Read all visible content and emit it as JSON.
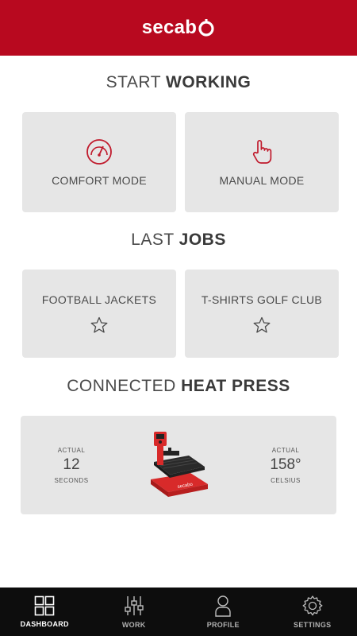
{
  "header": {
    "logo_text": "secab",
    "brand_color": "#b8091f"
  },
  "start_working": {
    "title_light": "START",
    "title_bold": "WORKING",
    "cards": [
      {
        "label": "COMFORT MODE",
        "icon": "gauge-icon"
      },
      {
        "label": "MANUAL MODE",
        "icon": "hand-pointer-icon"
      }
    ]
  },
  "last_jobs": {
    "title_light": "LAST",
    "title_bold": "JOBS",
    "jobs": [
      {
        "label": "FOOTBALL JACKETS",
        "icon": "star-outline-icon"
      },
      {
        "label": "T-SHIRTS GOLF CLUB",
        "icon": "star-outline-icon"
      }
    ]
  },
  "heat_press": {
    "title_light": "CONNECTED",
    "title_bold": "HEAT PRESS",
    "time": {
      "caption": "ACTUAL",
      "value": "12",
      "unit": "SECONDS"
    },
    "temperature": {
      "caption": "ACTUAL",
      "value": "158°",
      "unit": "CELSIUS"
    },
    "device_color": "#d82a2a"
  },
  "nav": {
    "items": [
      {
        "label": "DASHBOARD",
        "icon": "grid-icon",
        "active": true
      },
      {
        "label": "WORK",
        "icon": "sliders-icon",
        "active": false
      },
      {
        "label": "PROFILE",
        "icon": "user-icon",
        "active": false
      },
      {
        "label": "SETTINGS",
        "icon": "gear-icon",
        "active": false
      }
    ]
  }
}
